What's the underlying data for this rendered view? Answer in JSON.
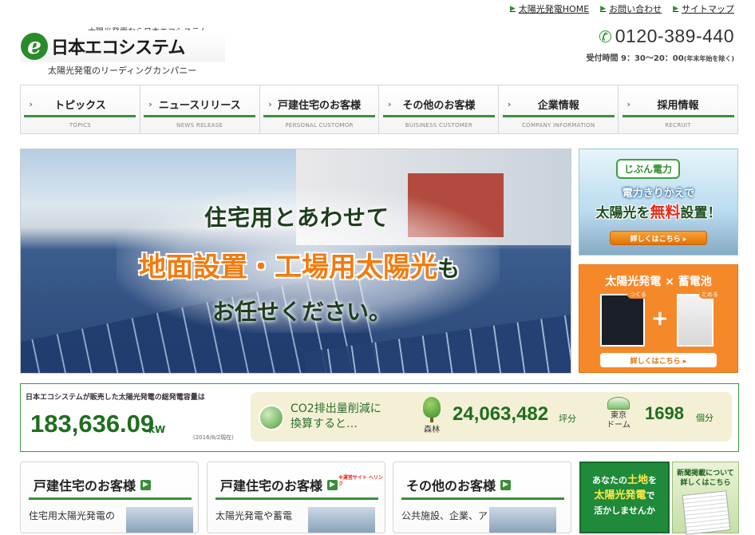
{
  "toplinks": [
    {
      "label": "太陽光発電HOME"
    },
    {
      "label": "お問い合わせ"
    },
    {
      "label": "サイトマップ"
    }
  ],
  "logo": {
    "tagline": "太陽光発電なら日本エコシステム",
    "mark": "e",
    "name": "日本エコシステム",
    "subtitle": "太陽光発電のリーディングカンパニー"
  },
  "contact": {
    "phone": "0120-389-440",
    "hours_label": "受付時間 9：30〜20：00",
    "hours_note": "(年末年始を除く)"
  },
  "nav": [
    {
      "label": "トピックス",
      "en": "TOPICS"
    },
    {
      "label": "ニュースリリース",
      "en": "NEWS RELEASE"
    },
    {
      "label": "戸建住宅のお客様",
      "en": "PERSONAL CUSTOMOR"
    },
    {
      "label": "その他のお客様",
      "en": "BUISINESS CUSTOMER"
    },
    {
      "label": "企業情報",
      "en": "COMPANY INFORMATION"
    },
    {
      "label": "採用情報",
      "en": "RECRUIT"
    }
  ],
  "hero": {
    "line1": "住宅用とあわせて",
    "line2": "地面設置・工場用太陽光",
    "line2_suffix": "も",
    "line3": "お任せください。"
  },
  "banner_jibun": {
    "logo": "じぶん電力",
    "line1": "電力きりかえで",
    "line2_a": "太陽光",
    "line2_b": "を",
    "line2_c": "無料",
    "line2_d": "設置！",
    "button": "詳しくはこちら ▸"
  },
  "banner_battery": {
    "title": "太陽光発電 × 蓄電池",
    "tag_left": "つくる",
    "tag_right": "ためる",
    "plus": "+",
    "button": "詳しくはこちら ▸"
  },
  "capacity": {
    "label": "日本エコシステムが販売した太陽光発電の総発電容量は",
    "value": "183,636.09",
    "unit": "kW",
    "date": "(2016/8/2現在)",
    "co2_text_1": "CO2排出量削減に",
    "co2_text_2": "換算すると…",
    "forest_label": "森林",
    "forest_value": "24,063,482",
    "forest_unit": "坪分",
    "dome_label_1": "東京",
    "dome_label_2": "ドーム",
    "dome_value": "1698",
    "dome_unit": "個分"
  },
  "cards": [
    {
      "title": "戸建住宅のお客様",
      "text": "住宅用太陽光発電の",
      "note": ""
    },
    {
      "title": "戸建住宅のお客様",
      "text": "太陽光発電や蓄電",
      "note": "※運営サイト へリンク"
    },
    {
      "title": "その他のお客様",
      "text": "公共施設、企業、ア",
      "note": ""
    }
  ],
  "banner_land": {
    "line1": "あなたの",
    "line1_y": "土地",
    "line1_b": "を",
    "line2": "太陽光発電",
    "line2_b": "で",
    "line3": "活かしませんか"
  },
  "banner_news": {
    "line1": "新聞掲載について",
    "line2": "詳しくはこちら"
  },
  "colors": {
    "brand_green": "#3a8e3a",
    "accent_orange": "#f27b0f",
    "text_green": "#1f6e1f"
  }
}
